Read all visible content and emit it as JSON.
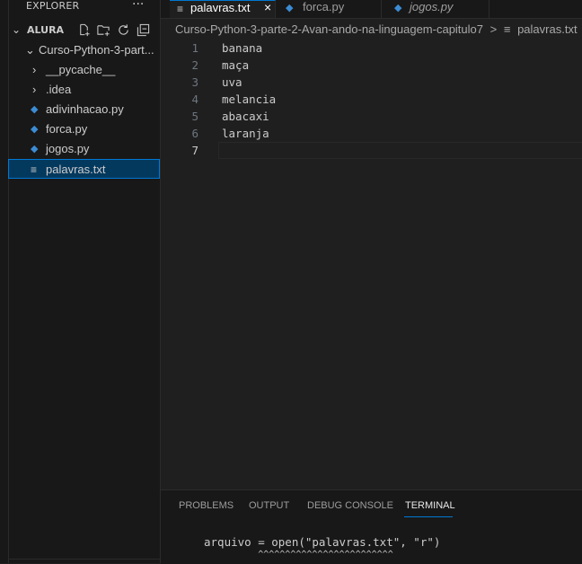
{
  "sidebar": {
    "title": "EXPLORER",
    "more": "···",
    "section": "ALURA",
    "section_chevron": "chevron-down-icon",
    "toolbar_icons": [
      "new-file-icon",
      "new-folder-icon",
      "refresh-icon",
      "collapse-all-icon"
    ],
    "tree": [
      {
        "label": "Curso-Python-3-part...",
        "icon": "chevron-down-icon",
        "type": "folder-open"
      },
      {
        "label": "__pycache__",
        "icon": "chevron-right-icon",
        "type": "folder"
      },
      {
        "label": ".idea",
        "icon": "chevron-right-icon",
        "type": "folder"
      },
      {
        "label": "adivinhacao.py",
        "icon": "python-icon",
        "type": "file"
      },
      {
        "label": "forca.py",
        "icon": "python-icon",
        "type": "file"
      },
      {
        "label": "jogos.py",
        "icon": "python-icon",
        "type": "file"
      },
      {
        "label": "palavras.txt",
        "icon": "text-file-icon",
        "type": "file",
        "selected": true
      }
    ]
  },
  "tabs": [
    {
      "label": "palavras.txt",
      "icon": "text-file-icon",
      "active": true,
      "close": "×"
    },
    {
      "label": "forca.py",
      "icon": "python-icon",
      "active": false
    },
    {
      "label": "jogos.py",
      "icon": "python-icon",
      "active": false,
      "italic": true
    }
  ],
  "breadcrumb": {
    "folder": "Curso-Python-3-parte-2-Avan-ando-na-linguagem-capitulo7",
    "separator": ">",
    "file": "palavras.txt"
  },
  "editor": {
    "lines": [
      {
        "num": "1",
        "text": "banana"
      },
      {
        "num": "2",
        "text": "maça"
      },
      {
        "num": "3",
        "text": "uva"
      },
      {
        "num": "4",
        "text": "melancia"
      },
      {
        "num": "5",
        "text": "abacaxi"
      },
      {
        "num": "6",
        "text": "laranja"
      },
      {
        "num": "7",
        "text": ""
      }
    ],
    "current_line": 7
  },
  "panel": {
    "tabs": [
      "PROBLEMS",
      "OUTPUT",
      "DEBUG CONSOLE",
      "TERMINAL"
    ],
    "active_tab": "TERMINAL",
    "terminal_lines": [
      "arquivo = open(\"palavras.txt\", \"r\")",
      "          ^^^^^^^^^^^^^^^^^^^^^^^^^"
    ]
  },
  "colors": {
    "accent": "#0078d4",
    "python": "#3c8cd4",
    "background": "#1f1f1f",
    "sidebar": "#181818"
  }
}
